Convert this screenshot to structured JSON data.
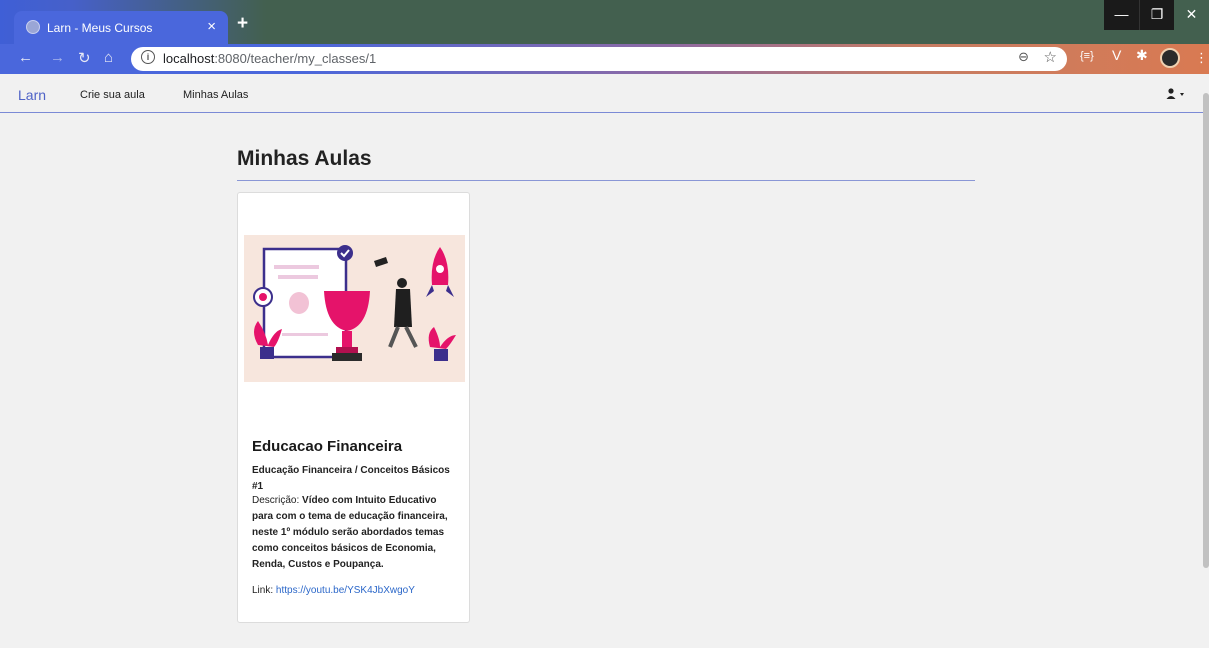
{
  "browser": {
    "tab_title": "Larn - Meus Cursos",
    "tab_close": "×",
    "new_tab": "+",
    "url_host": "localhost",
    "url_path": ":8080/teacher/my_classes/1",
    "window_controls": {
      "minimize": "—",
      "maximize": "❐",
      "close": "✕"
    },
    "extensions": [
      "{≡}",
      "V",
      "✱"
    ]
  },
  "navbar": {
    "brand": "Larn",
    "links": [
      "Crie sua aula",
      "Minhas Aulas"
    ],
    "user_menu_icon": "user-icon"
  },
  "page": {
    "heading": "Minhas Aulas"
  },
  "cards": [
    {
      "image_alt": "trophy-graduation-illustration",
      "title": "Educacao Financeira",
      "subtitle": "Educação Financeira / Conceitos Básicos #1",
      "desc_label": "Descrição:",
      "desc_text": "Vídeo com Intuito Educativo para com o tema de educação financeira, neste 1º módulo serão abordados temas como conceitos básicos de Economia, Renda, Custos e Poupança.",
      "link_label": "Link:",
      "link_url": "https://youtu.be/YSK4JbXwgoY"
    }
  ],
  "colors": {
    "accent": "#4f63c7",
    "link": "#2b67c9"
  }
}
